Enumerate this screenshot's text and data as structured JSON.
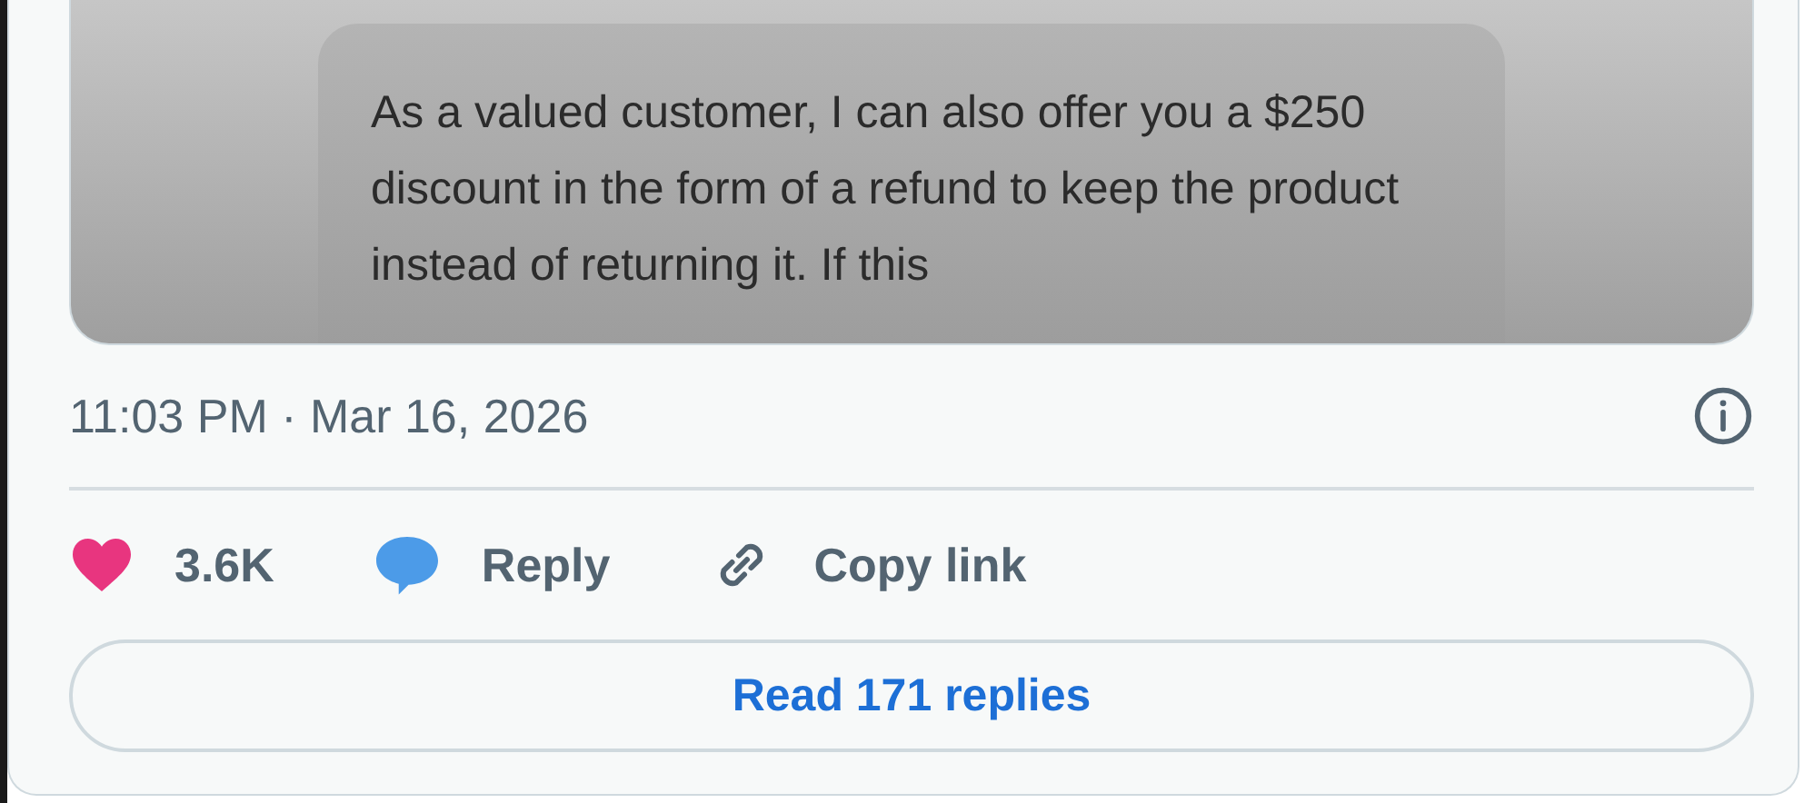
{
  "media": {
    "message": "As a valued customer, I can also offer you a $250 discount in the form of a refund to keep the product instead of returning it. If this"
  },
  "timestamp": "11:03 PM · Mar 16, 2026",
  "actions": [
    {
      "kind": "like",
      "label": "3.6K"
    },
    {
      "kind": "reply",
      "label": "Reply"
    },
    {
      "kind": "copy",
      "label": "Copy link"
    }
  ],
  "read_replies_button": "Read 171 replies"
}
